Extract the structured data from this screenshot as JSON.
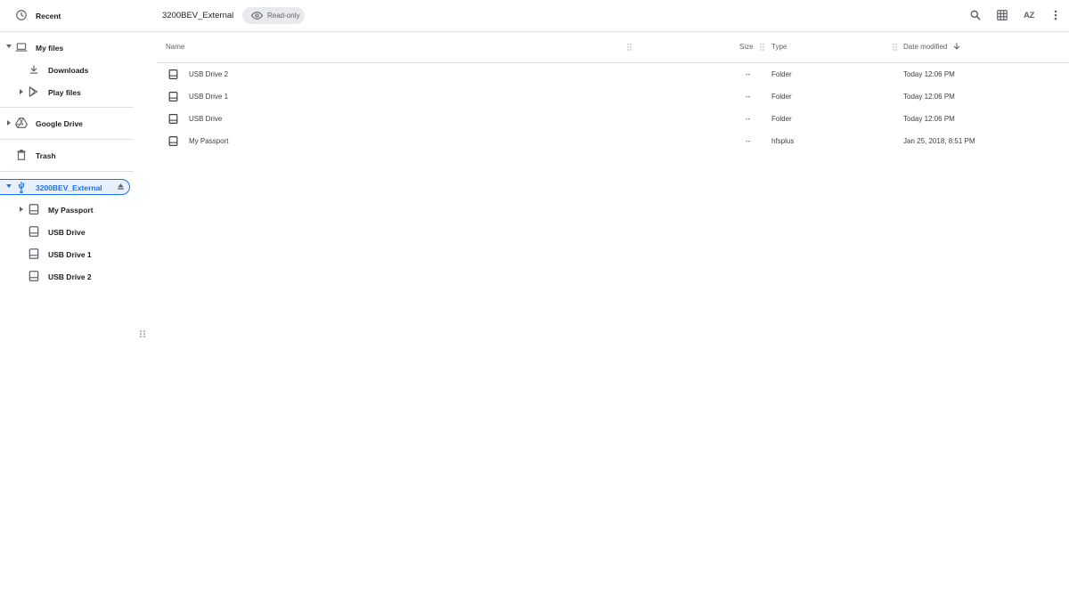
{
  "sidebar": {
    "items": [
      {
        "label": "Recent",
        "icon": "clock-icon"
      },
      {
        "label": "My files",
        "icon": "laptop-icon"
      },
      {
        "label": "Downloads",
        "icon": "download-icon"
      },
      {
        "label": "Play files",
        "icon": "play-store-icon"
      },
      {
        "label": "Google Drive",
        "icon": "google-drive-icon"
      },
      {
        "label": "Trash",
        "icon": "trash-icon"
      },
      {
        "label": "3200BEV_External",
        "icon": "usb-icon"
      },
      {
        "label": "My Passport",
        "icon": "drive-icon"
      },
      {
        "label": "USB Drive",
        "icon": "drive-icon"
      },
      {
        "label": "USB Drive 1",
        "icon": "drive-icon"
      },
      {
        "label": "USB Drive 2",
        "icon": "drive-icon"
      }
    ]
  },
  "header": {
    "breadcrumb": "3200BEV_External",
    "readonly_label": "Read-only",
    "sort_label": "AZ"
  },
  "columns": {
    "name": "Name",
    "size": "Size",
    "type": "Type",
    "date": "Date modified"
  },
  "files": [
    {
      "name": "USB Drive 2",
      "size": "--",
      "type": "Folder",
      "date": "Today 12:06 PM"
    },
    {
      "name": "USB Drive 1",
      "size": "--",
      "type": "Folder",
      "date": "Today 12:06 PM"
    },
    {
      "name": "USB Drive",
      "size": "--",
      "type": "Folder",
      "date": "Today 12:06 PM"
    },
    {
      "name": "My Passport",
      "size": "--",
      "type": "hfsplus",
      "date": "Jan 25, 2018, 8:51 PM"
    }
  ],
  "colors": {
    "accent": "#1a73e8",
    "icon": "#5f6368",
    "divider": "#e0e0e0"
  }
}
